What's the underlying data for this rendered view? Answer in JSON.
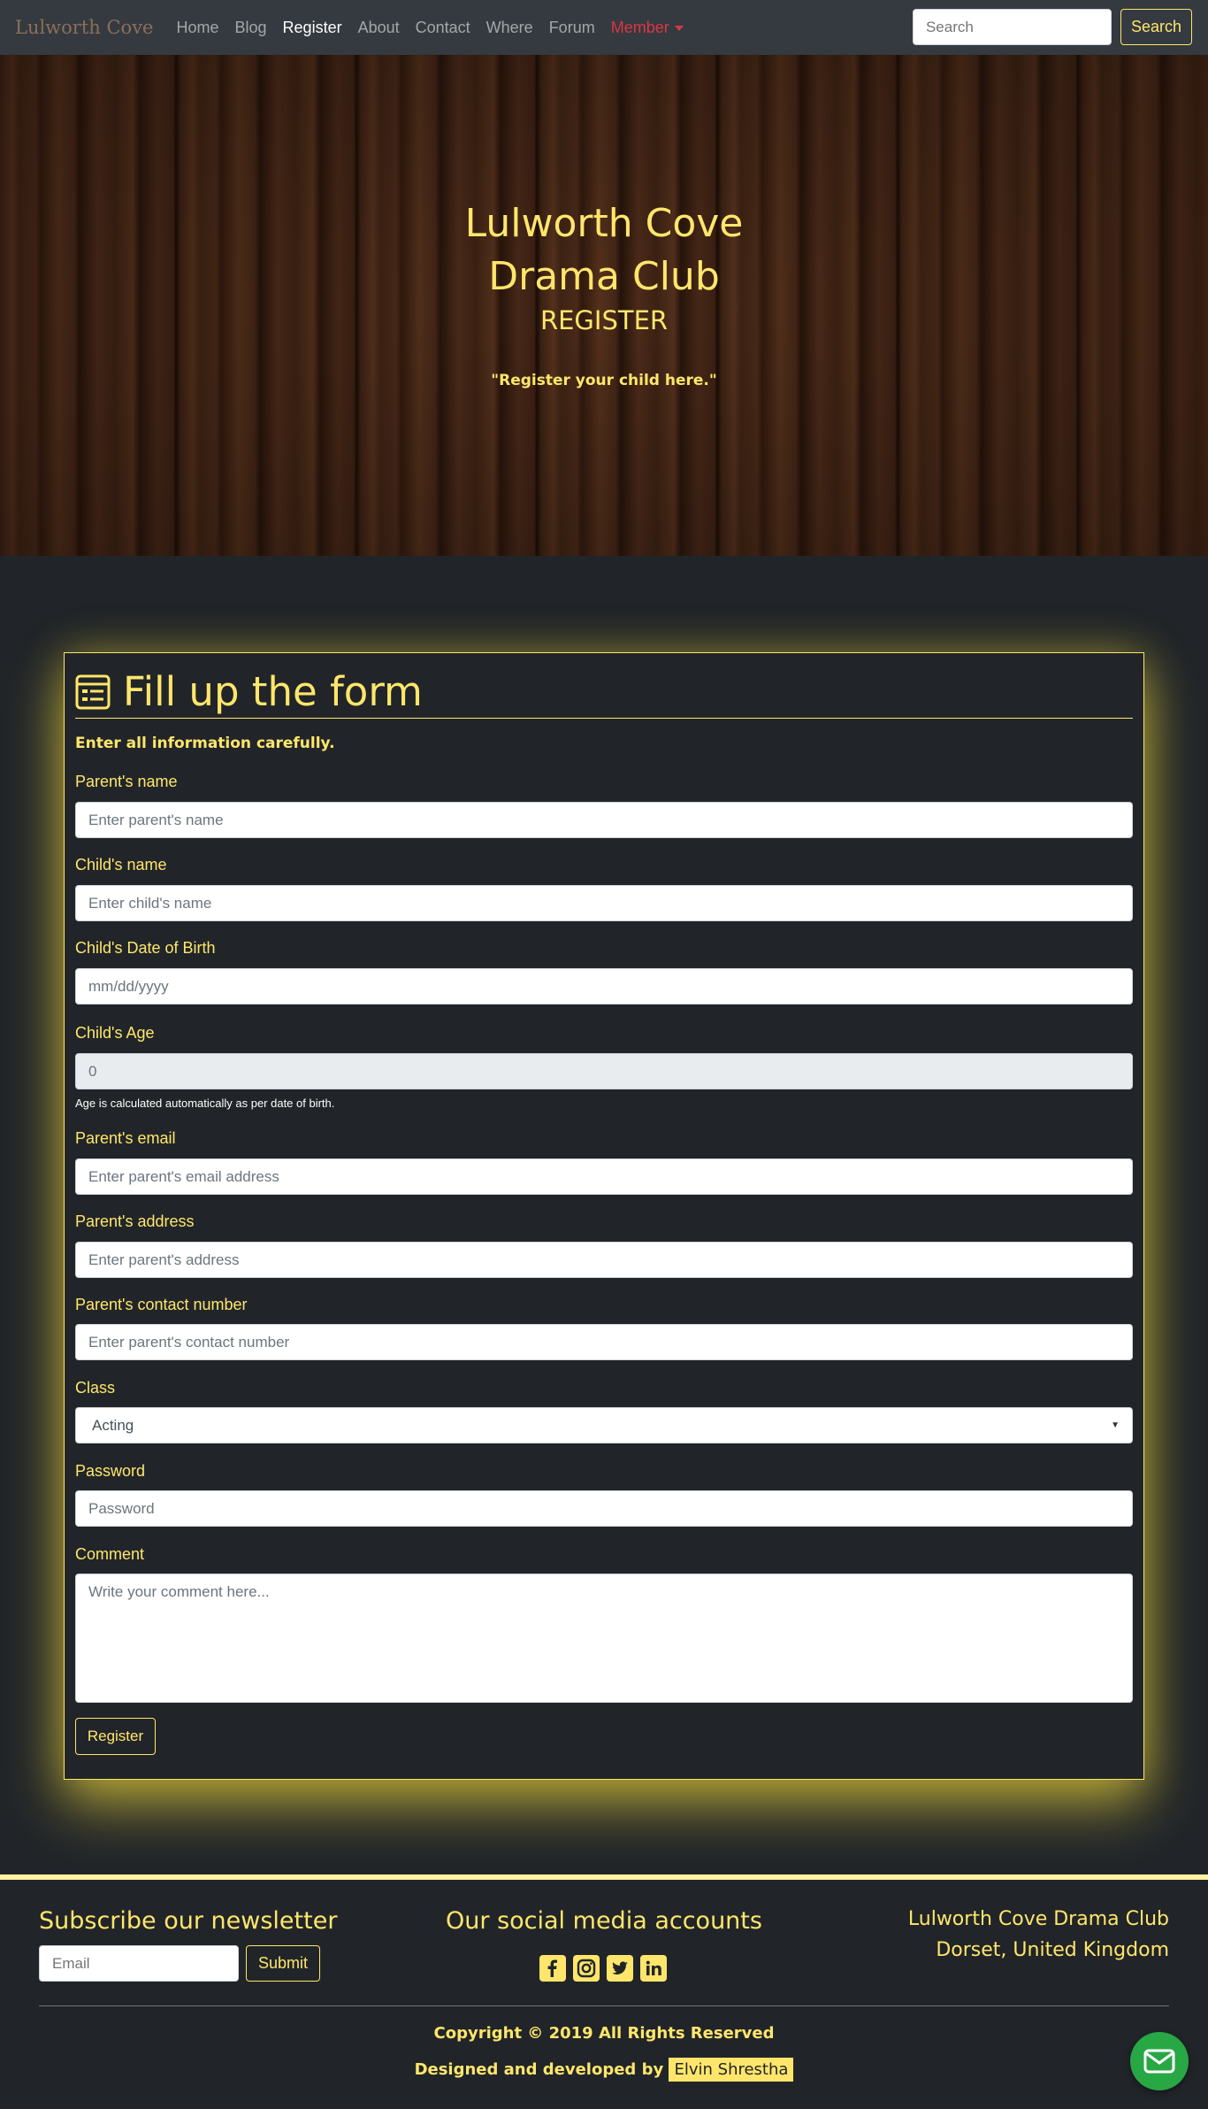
{
  "navbar": {
    "brand": "Lulworth Cove",
    "links": [
      "Home",
      "Blog",
      "Register",
      "About",
      "Contact",
      "Where",
      "Forum"
    ],
    "member": "Member",
    "search_placeholder": "Search",
    "search_button": "Search"
  },
  "hero": {
    "title_line1": "Lulworth Cove",
    "title_line2": "Drama Club",
    "subtitle": "REGISTER",
    "quote": "\"Register your child here.\""
  },
  "form": {
    "title": "Fill up the form",
    "note": "Enter all information carefully.",
    "parent_name": {
      "label": "Parent's name",
      "placeholder": "Enter parent's name"
    },
    "child_name": {
      "label": "Child's name",
      "placeholder": "Enter child's name"
    },
    "dob": {
      "label": "Child's Date of Birth",
      "placeholder": "mm/dd/yyyy"
    },
    "age": {
      "label": "Child's Age",
      "value": "0",
      "help": "Age is calculated automatically as per date of birth."
    },
    "email": {
      "label": "Parent's email",
      "placeholder": "Enter parent's email address"
    },
    "address": {
      "label": "Parent's address",
      "placeholder": "Enter parent's address"
    },
    "contact": {
      "label": "Parent's contact number",
      "placeholder": "Enter parent's contact number"
    },
    "class": {
      "label": "Class",
      "value": "Acting"
    },
    "password": {
      "label": "Password",
      "placeholder": "Password"
    },
    "comment": {
      "label": "Comment",
      "placeholder": "Write your comment here..."
    },
    "submit": "Register"
  },
  "footer": {
    "newsletter_heading": "Subscribe our newsletter",
    "newsletter_placeholder": "Email",
    "newsletter_button": "Submit",
    "social_heading": "Our social media accounts",
    "social_icons": [
      "facebook-icon",
      "instagram-icon",
      "twitter-icon",
      "linkedin-icon"
    ],
    "club_name": "Lulworth Cove Drama Club",
    "location": "Dorset, United Kingdom",
    "copyright": "Copyright © 2019 All Rights Reserved",
    "designed_by": "Designed and developed by",
    "designer": "Elvin Shrestha"
  },
  "colors": {
    "accent": "#ffe66b",
    "background": "#212529",
    "navbar": "#343a40",
    "member": "#dc3545",
    "fab": "#28a745"
  }
}
